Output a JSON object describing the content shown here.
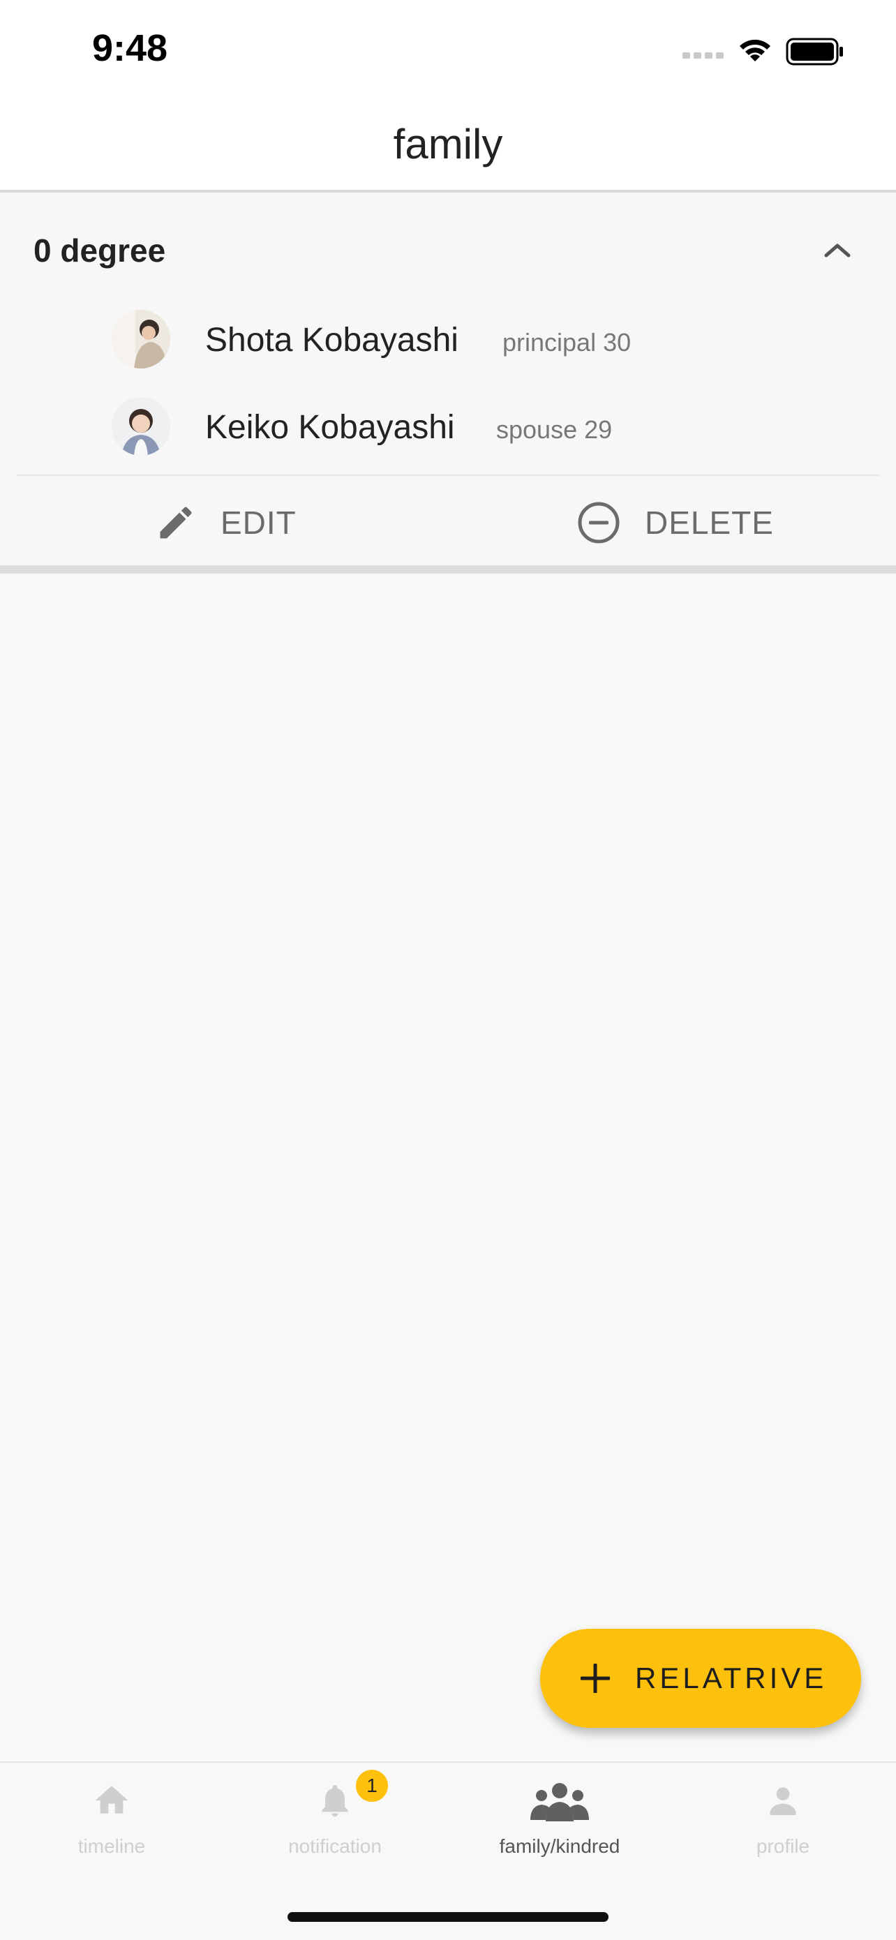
{
  "status_bar": {
    "time": "9:48"
  },
  "header": {
    "title": "family"
  },
  "degree_section": {
    "title": "0 degree",
    "members": [
      {
        "name": "Shota Kobayashi",
        "role": "principal 30"
      },
      {
        "name": "Keiko Kobayashi",
        "role": "spouse 29"
      }
    ],
    "actions": {
      "edit_label": "EDIT",
      "delete_label": "DELETE"
    }
  },
  "fab": {
    "label": "RELATRIVE"
  },
  "bottom_nav": {
    "items": [
      {
        "label": "timeline",
        "icon": "home-icon"
      },
      {
        "label": "notification",
        "icon": "bell-icon",
        "badge": "1"
      },
      {
        "label": "family/kindred",
        "icon": "group-icon"
      },
      {
        "label": "profile",
        "icon": "person-icon"
      }
    ],
    "active_index": 2
  },
  "colors": {
    "accent": "#fdc00c",
    "background": "#f8f8f8",
    "text_primary": "#222222",
    "text_secondary": "#777777",
    "inactive_nav": "#cfcfcf"
  }
}
